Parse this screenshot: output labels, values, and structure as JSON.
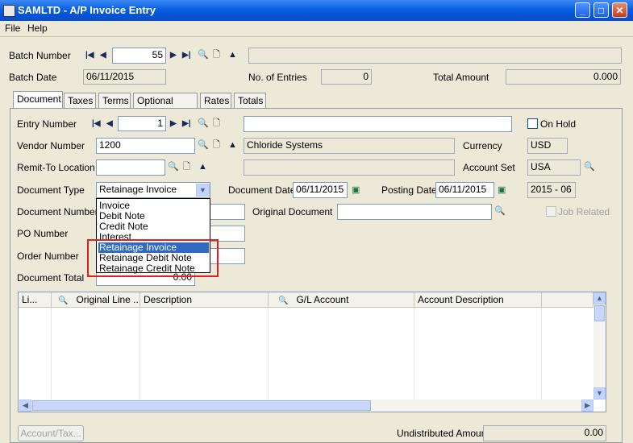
{
  "window": {
    "title": "SAMLTD - A/P Invoice Entry"
  },
  "menu": {
    "file": "File",
    "help": "Help"
  },
  "batch": {
    "number_label": "Batch Number",
    "number": "55",
    "description": "",
    "date_label": "Batch Date",
    "date": "06/11/2015",
    "entries_label": "No. of Entries",
    "entries": "0",
    "total_label": "Total Amount",
    "total": "0.000"
  },
  "tabs": [
    {
      "label": "Document"
    },
    {
      "label": "Taxes"
    },
    {
      "label": "Terms"
    },
    {
      "label": "Optional Fields"
    },
    {
      "label": "Rates"
    },
    {
      "label": "Totals"
    }
  ],
  "document": {
    "entry_label": "Entry Number",
    "entry_number": "1",
    "entry_description": "",
    "on_hold_label": "On Hold",
    "vendor_label": "Vendor Number",
    "vendor_number": "1200",
    "vendor_name": "Chloride Systems",
    "currency_label": "Currency",
    "currency": "USD",
    "remit_label": "Remit-To Location",
    "remit": "",
    "remit_name": "",
    "account_set_label": "Account Set",
    "account_set": "USA",
    "doc_type_label": "Document Type",
    "doc_type": "Retainage Invoice",
    "doc_date_label": "Document Date",
    "doc_date": "06/11/2015",
    "posting_date_label": "Posting Date",
    "posting_date": "06/11/2015",
    "period": "2015 - 06",
    "doc_number_label": "Document Number",
    "orig_doc_label": "Original Document",
    "job_related_label": "Job Related",
    "po_label": "PO Number",
    "order_label": "Order Number",
    "doc_total_label": "Document Total",
    "doc_total": "0.00"
  },
  "doc_type_options": [
    "Invoice",
    "Debit Note",
    "Credit Note",
    "Interest",
    "Retainage Invoice",
    "Retainage Debit Note",
    "Retainage Credit Note"
  ],
  "grid": {
    "columns": [
      "Li...",
      "Original Line ...",
      "Description",
      "G/L Account",
      "Account Description"
    ]
  },
  "footer": {
    "account_tax_button": "Account/Tax...",
    "undistributed_label": "Undistributed Amount",
    "undistributed": "0.00"
  },
  "colors": {
    "titlebar": "#0a5fe0",
    "selection": "#316ac5",
    "highlight_box": "#e02020"
  }
}
